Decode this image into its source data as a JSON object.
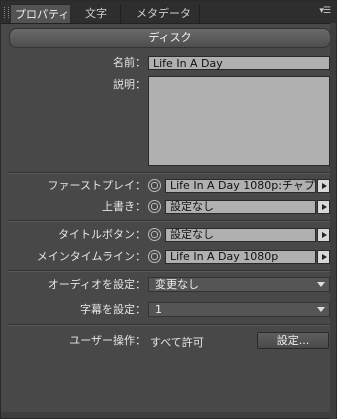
{
  "tabs": [
    {
      "label": "プロパティ",
      "close": "×"
    },
    {
      "label": "文字"
    },
    {
      "label": "メタデータ"
    }
  ],
  "panel_menu_icon": "panel-menu-icon",
  "header": {
    "title": "ディスク"
  },
  "fields": {
    "name": {
      "label": "名前：",
      "value": "Life In A Day"
    },
    "description": {
      "label": "説明：",
      "value": ""
    }
  },
  "pickers": {
    "first_play": {
      "label": "ファーストプレイ：",
      "value": "Life In A Day 1080p:チャプ..."
    },
    "override": {
      "label": "上書き：",
      "value": "設定なし"
    },
    "title_button": {
      "label": "タイトルボタン：",
      "value": "設定なし"
    },
    "main_timeline": {
      "label": "メインタイムライン：",
      "value": "Life In A Day 1080p"
    }
  },
  "selects": {
    "audio": {
      "label": "オーディオを設定：",
      "value": "変更なし"
    },
    "subtitle": {
      "label": "字幕を設定：",
      "value": "1"
    }
  },
  "user_ops": {
    "label": "ユーザー操作：",
    "value": "すべて許可",
    "button": "設定..."
  }
}
